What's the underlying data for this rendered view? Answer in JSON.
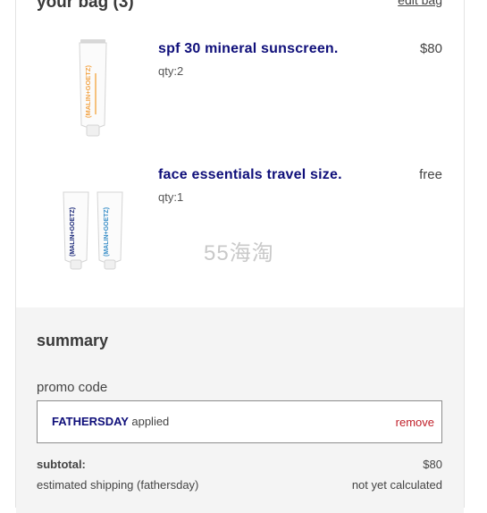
{
  "bag": {
    "title": "your bag (3)",
    "edit_label": "edit bag",
    "items": [
      {
        "name": "spf 30 mineral sunscreen.",
        "qty": "qty:2",
        "price": "$80",
        "image": "sunscreen-tube-image",
        "tube_label": "(MALIN+GOETZ)"
      },
      {
        "name": "face essentials travel size.",
        "qty": "qty:1",
        "price": "free",
        "image": "travel-tubes-image",
        "tube_label": "(MALIN+GOETZ)"
      }
    ]
  },
  "watermark": "55海淘",
  "summary": {
    "title": "summary",
    "promo_label": "promo code",
    "promo_code": "FATHERSDAY",
    "promo_status": "applied",
    "promo_remove": "remove",
    "subtotal_label": "subtotal:",
    "subtotal_value": "$80",
    "shipping_label": "estimated shipping (fathersday)",
    "shipping_value": "not yet calculated"
  },
  "colors": {
    "product_name": "#0f0f7a",
    "remove_link": "#c0202a",
    "summary_bg": "#f4f4f4",
    "tube_orange": "#f3a64a",
    "tube_navy": "#1d2a7a",
    "tube_blue": "#3a8fc8"
  }
}
